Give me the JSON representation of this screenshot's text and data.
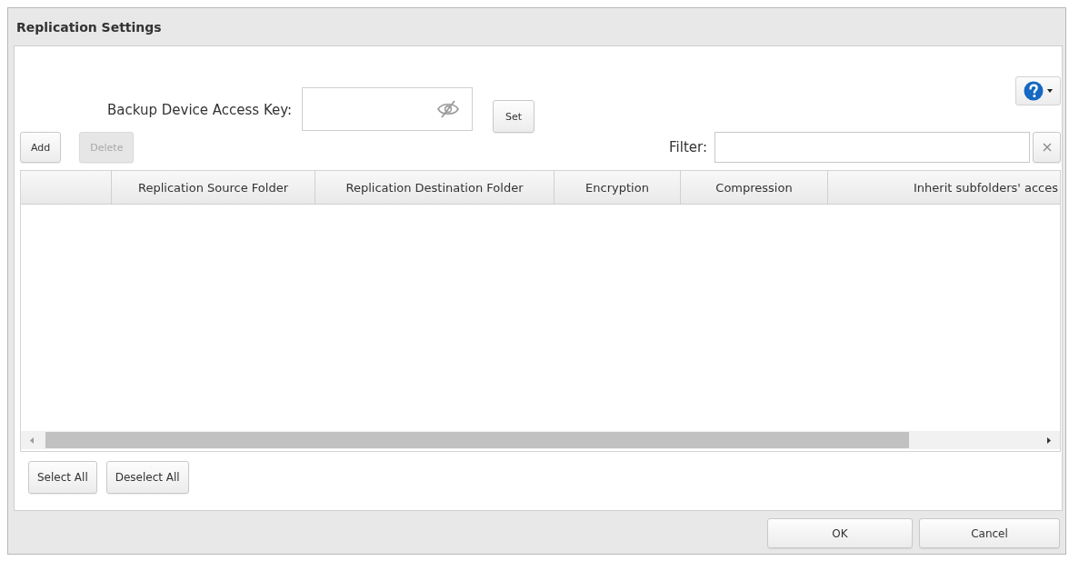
{
  "window": {
    "title": "Replication Settings"
  },
  "access_key": {
    "label": "Backup Device Access Key:",
    "button": "Set"
  },
  "toolbar": {
    "buttons": [
      {
        "label": "Add",
        "disabled": false
      },
      {
        "label": "Delete",
        "disabled": true
      }
    ],
    "filter_label": "Filter:"
  },
  "table": {
    "columns": [
      "Replication Source Folder",
      "Replication Destination Folder",
      "Encryption",
      "Compression",
      "Inherit subfolders' acces"
    ]
  },
  "selection_buttons": [
    "Select All",
    "Deselect All"
  ],
  "footer_buttons": [
    "OK",
    "Cancel"
  ]
}
